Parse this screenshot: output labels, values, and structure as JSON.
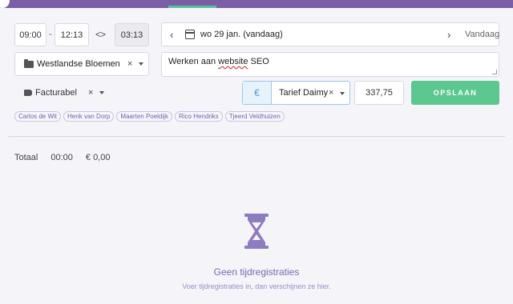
{
  "timer": {
    "start": "09:00",
    "separator": "-",
    "end": "12:13",
    "swap_icon": "<>",
    "duration": "03:13"
  },
  "date": {
    "prev_icon": "chevron-left-icon",
    "calendar_icon": "calendar-icon",
    "label": "wo 29 jan. (vandaag)",
    "next_icon": "chevron-right-icon",
    "today_label": "Vandaag"
  },
  "project": {
    "name": "Westlandse Bloemen",
    "clear": "×"
  },
  "description": {
    "prefix": "Werken aan ",
    "misspelled": "website",
    "suffix": " SEO"
  },
  "billing": {
    "label": "Facturabel",
    "clear": "×"
  },
  "rate": {
    "currency_symbol": "€",
    "name": "Tarief Daimy",
    "clear": "×",
    "amount": "337,75"
  },
  "save_label": "OPSLAAN",
  "persons": [
    "Carlos de Wit",
    "Henk van Dorp",
    "Maarten Poeldijk",
    "Rico Hendriks",
    "Tjeerd Veldhuizen"
  ],
  "totals": {
    "label": "Totaal",
    "time": "00:00",
    "amount": "€ 0,00"
  },
  "empty": {
    "icon": "hourglass-icon",
    "title": "Geen tijdregistraties",
    "subtitle": "Voer tijdregistraties in, dan verschijnen ze hier."
  },
  "colors": {
    "header": "#7b5ea7",
    "accent": "#5cc88f",
    "hourglass": "#8d7cc0"
  }
}
